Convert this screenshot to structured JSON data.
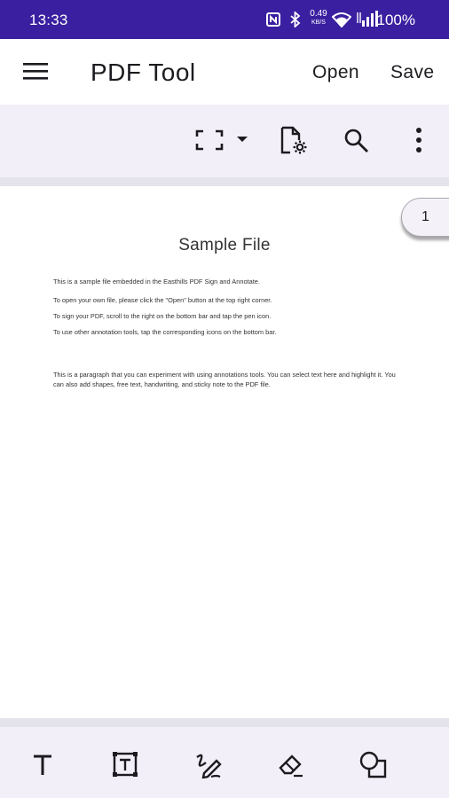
{
  "status_bar": {
    "time": "13:33",
    "speed_value": "0.49",
    "speed_unit": "KB/S",
    "battery": "100%"
  },
  "app_bar": {
    "title": "PDF Tool",
    "open_label": "Open",
    "save_label": "Save"
  },
  "toolbar": {
    "icons": [
      "fit-screen-icon",
      "dropdown-arrow-icon",
      "document-settings-icon",
      "search-icon",
      "more-vert-icon"
    ]
  },
  "page_indicator": "1",
  "document": {
    "title": "Sample File",
    "lines": [
      "This is a sample file embedded in the Easthills PDF Sign and Annotate.",
      "To open your own file, please click the \"Open\" button at the top right corner.",
      "To sign your PDF, scroll to the right on the bottom bar and tap the pen icon.",
      "To use other annotation tools, tap the corresponding icons on the bottom bar."
    ],
    "paragraph": "This is a paragraph that you can experiment with using annotations tools. You can select text here and highlight it. You can also add shapes, free text, handwriting, and sticky note to the PDF file."
  },
  "bottom_bar": {
    "tools": [
      "text-icon",
      "text-box-icon",
      "draw-icon",
      "eraser-icon",
      "shapes-icon"
    ]
  },
  "colors": {
    "status_bar": "#3a1fa0",
    "toolbar_bg": "#f3eff8",
    "divider": "#e4e2ea"
  }
}
